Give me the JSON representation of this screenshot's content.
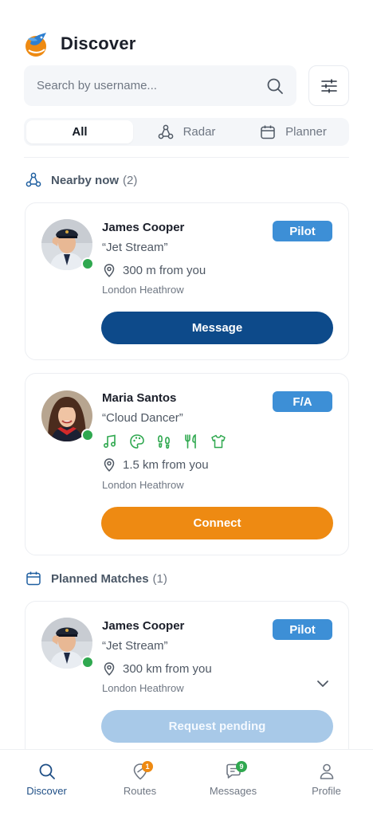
{
  "header": {
    "title": "Discover"
  },
  "search": {
    "placeholder": "Search by username..."
  },
  "tabs": [
    {
      "label": "All",
      "active": true
    },
    {
      "label": "Radar",
      "icon": "radar-icon"
    },
    {
      "label": "Planner",
      "icon": "calendar-icon"
    }
  ],
  "nearby": {
    "label": "Nearby now",
    "count": "(2)",
    "cards": [
      {
        "name": "James Cooper",
        "nickname": "“Jet Stream”",
        "distance": "300 m from you",
        "airport": "London Heathrow",
        "role": "Pilot",
        "action": "Message"
      },
      {
        "name": "Maria Santos",
        "nickname": "“Cloud Dancer”",
        "distance": "1.5 km from you",
        "airport": "London Heathrow",
        "role": "F/A",
        "action": "Connect",
        "interests": [
          "music-icon",
          "palette-icon",
          "footprints-icon",
          "utensils-icon",
          "shirt-icon"
        ]
      }
    ]
  },
  "planned": {
    "label": "Planned Matches",
    "count": "(1)",
    "cards": [
      {
        "name": "James Cooper",
        "nickname": "“Jet Stream”",
        "distance": "300 km from you",
        "airport": "London Heathrow",
        "role": "Pilot",
        "action": "Request pending"
      }
    ]
  },
  "nav": [
    {
      "label": "Discover",
      "icon": "search-icon",
      "active": true
    },
    {
      "label": "Routes",
      "icon": "route-icon",
      "badge": "1"
    },
    {
      "label": "Messages",
      "icon": "chat-icon",
      "badge": "9"
    },
    {
      "label": "Profile",
      "icon": "user-icon"
    }
  ],
  "colors": {
    "primary": "#0d4a8a",
    "accent": "#ee8a12",
    "badge": "#3d8fd6",
    "online": "#2fa84f",
    "green_icons": "#2fa84f"
  }
}
